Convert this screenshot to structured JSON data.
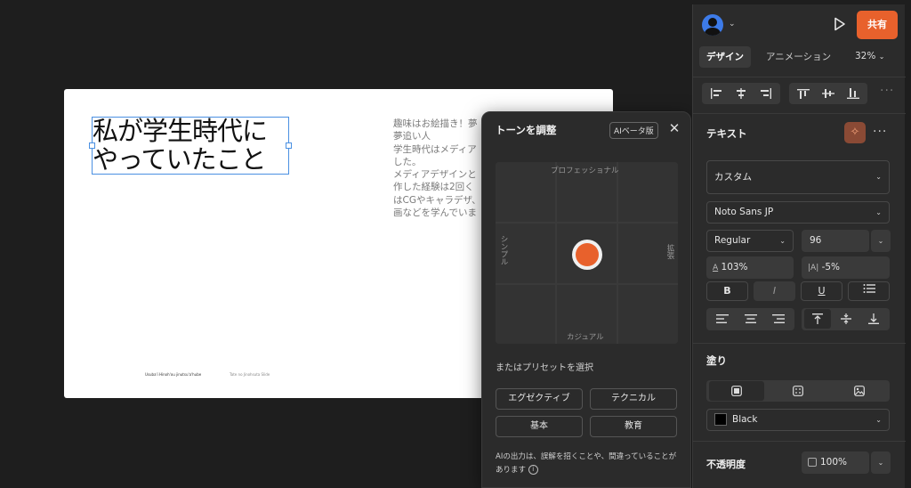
{
  "slide": {
    "title": "私が学生時代に\nやっていたこと",
    "title_line1": "私が学生時代に",
    "title_line2": "やっていたこと",
    "body": "趣味はお絵描き！夢\n夢追い人\n学生時代はメディア\nした。\nメディアデザインと\n作した経験は2回く\nはCGやキャラデザ、\n画などを学んでいま",
    "footer_left": "Usuba'i Hinoh'ou jinutsu'a'hube",
    "footer_right": "Tate no Jinohsuta Slide"
  },
  "tone_panel": {
    "title": "トーンを調整",
    "beta_badge": "AIベータ版",
    "close_icon": "close-icon",
    "axis_top": "プロフェッショナル",
    "axis_bottom": "カジュアル",
    "axis_left": "シンプル",
    "axis_right": "拡張",
    "preset_label": "またはプリセットを選択",
    "presets": [
      "エグゼクティブ",
      "テクニカル",
      "基本",
      "教育"
    ],
    "disclaimer": "AIの出力は、誤解を招くことや、間違っていることがあります",
    "accent": "#e8612c"
  },
  "panel": {
    "share_label": "共有",
    "tabs": [
      "デザイン",
      "アニメーション"
    ],
    "zoom": "32%",
    "text_section": "テキスト",
    "font_style": "カスタム",
    "font_family": "Noto Sans JP",
    "font_weight": "Regular",
    "font_size": "96",
    "line_height": "103%",
    "letter_spacing": "-5%",
    "line_height_icon": "A",
    "letter_spacing_icon": "|A|",
    "bold": "B",
    "italic": "I",
    "underline": "U",
    "fill_section": "塗り",
    "fill_color": "Black",
    "opacity_section": "不透明度",
    "opacity_value": "100%"
  }
}
